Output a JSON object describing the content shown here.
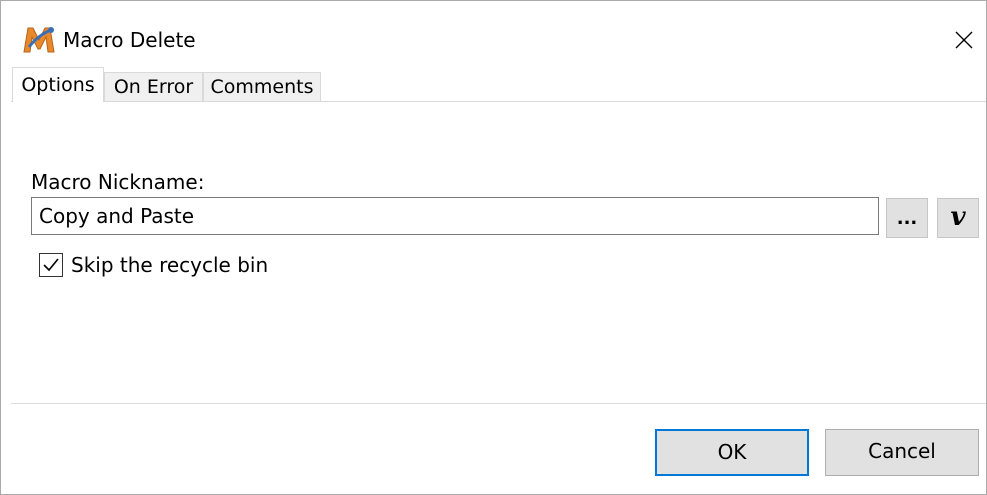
{
  "window": {
    "title": "Macro Delete",
    "app_icon": "macro-m-icon",
    "close_icon": "close-icon"
  },
  "tabs": [
    {
      "label": "Options",
      "active": true
    },
    {
      "label": "On Error",
      "active": false
    },
    {
      "label": "Comments",
      "active": false
    }
  ],
  "options": {
    "nickname_label": "Macro Nickname:",
    "nickname_value": "Copy and Paste",
    "browse_label": "...",
    "variable_label": "v",
    "skip_recycle_label": "Skip the recycle bin",
    "skip_recycle_checked": true
  },
  "footer": {
    "ok_label": "OK",
    "cancel_label": "Cancel"
  },
  "colors": {
    "accent": "#0078d7"
  }
}
